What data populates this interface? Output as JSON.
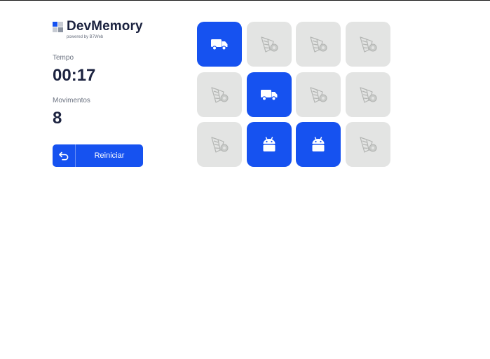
{
  "logo": {
    "name": "DevMemory",
    "subtitle": "powered by B7Web"
  },
  "stats": {
    "time_label": "Tempo",
    "time_value": "00:17",
    "moves_label": "Movimentos",
    "moves_value": "8"
  },
  "restart": {
    "label": "Reiniciar",
    "icon": "undo-arrow-icon"
  },
  "colors": {
    "accent": "#1652f0",
    "card_back": "#e3e4e3",
    "text_dark": "#1c2340",
    "text_muted": "#6b7280"
  },
  "board": {
    "columns": 4,
    "rows": 3,
    "cards": [
      {
        "state": "revealed",
        "icon": "truck-icon"
      },
      {
        "state": "hidden",
        "icon": "card-back-icon"
      },
      {
        "state": "hidden",
        "icon": "card-back-icon"
      },
      {
        "state": "hidden",
        "icon": "card-back-icon"
      },
      {
        "state": "hidden",
        "icon": "card-back-icon"
      },
      {
        "state": "revealed",
        "icon": "truck-icon"
      },
      {
        "state": "hidden",
        "icon": "card-back-icon"
      },
      {
        "state": "hidden",
        "icon": "card-back-icon"
      },
      {
        "state": "hidden",
        "icon": "card-back-icon"
      },
      {
        "state": "revealed",
        "icon": "android-icon"
      },
      {
        "state": "revealed",
        "icon": "android-icon"
      },
      {
        "state": "hidden",
        "icon": "card-back-icon"
      }
    ]
  }
}
